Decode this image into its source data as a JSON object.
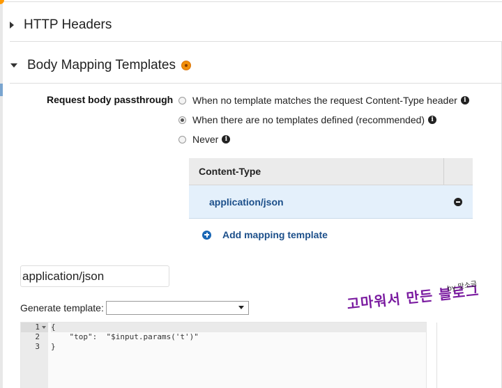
{
  "sections": {
    "http_headers": "HTTP Headers",
    "body_mapping": "Body Mapping Templates"
  },
  "passthrough": {
    "label": "Request body passthrough",
    "options": [
      {
        "label": "When no template matches the request Content-Type header",
        "selected": false,
        "info": true
      },
      {
        "label": "When there are no templates defined (recommended)",
        "selected": true,
        "info": true
      },
      {
        "label": "Never",
        "selected": false,
        "info": true
      }
    ]
  },
  "content_type_table": {
    "header": "Content-Type",
    "rows": [
      "application/json"
    ]
  },
  "add_template_label": "Add mapping template",
  "content_type_input": "application/json",
  "generate_template": {
    "label": "Generate template:",
    "selected": ""
  },
  "editor": {
    "line_numbers": [
      "1",
      "2",
      "3"
    ],
    "lines": [
      "{",
      "    \"top\":  \"$input.params('t')\"",
      "}"
    ]
  },
  "watermark": {
    "main": "고마워서 만든 블로그",
    "by": "by 맛소금"
  },
  "colors": {
    "accent_warning": "#f28f0a",
    "link_blue": "#1c4f8a",
    "row_selected": "#e4f0fb",
    "watermark": "#7a1ba0"
  },
  "icons": {
    "info": "info-icon",
    "remove": "minus-circle-icon",
    "add": "plus-circle-icon",
    "warning": "warning-dot-icon"
  }
}
